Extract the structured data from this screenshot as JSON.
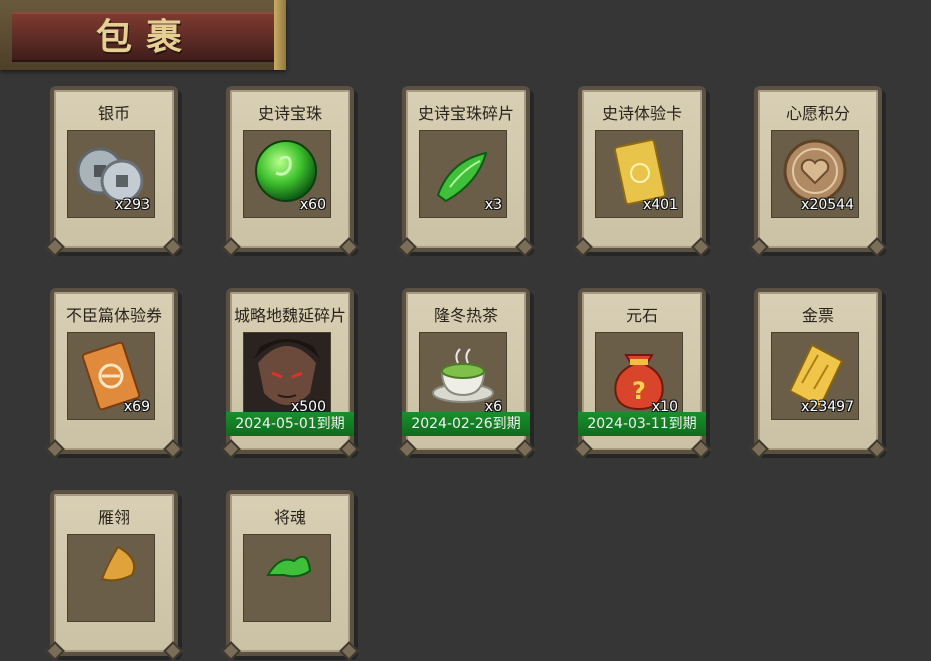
{
  "header": {
    "title": "包裹"
  },
  "items": [
    {
      "name": "银币",
      "qty": "x293",
      "expire": ""
    },
    {
      "name": "史诗宝珠",
      "qty": "x60",
      "expire": ""
    },
    {
      "name": "史诗宝珠碎片",
      "qty": "x3",
      "expire": ""
    },
    {
      "name": "史诗体验卡",
      "qty": "x401",
      "expire": ""
    },
    {
      "name": "心愿积分",
      "qty": "x20544",
      "expire": ""
    },
    {
      "name": "不臣篇体验券",
      "qty": "x69",
      "expire": ""
    },
    {
      "name": "城略地魏延碎片",
      "qty": "x500",
      "expire": "2024-05-01到期"
    },
    {
      "name": "隆冬热茶",
      "qty": "x6",
      "expire": "2024-02-26到期"
    },
    {
      "name": "元石",
      "qty": "x10",
      "expire": "2024-03-11到期"
    },
    {
      "name": "金票",
      "qty": "x23497",
      "expire": ""
    },
    {
      "name": "雁翎",
      "qty": "",
      "expire": ""
    },
    {
      "name": "将魂",
      "qty": "",
      "expire": ""
    }
  ]
}
